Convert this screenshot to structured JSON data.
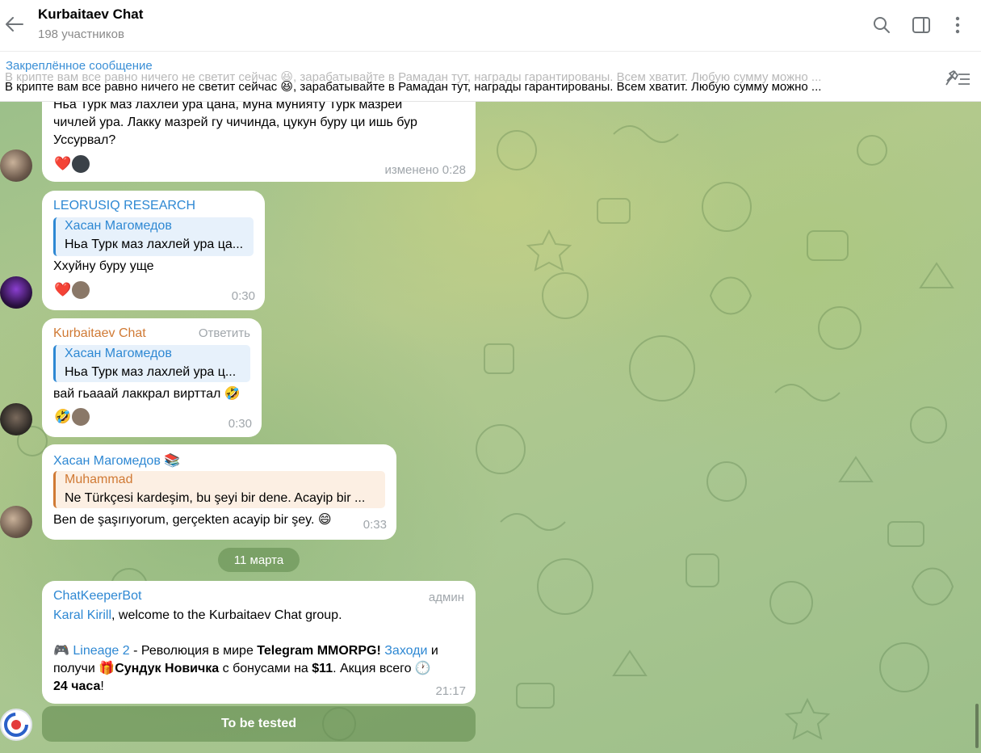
{
  "header": {
    "title": "Kurbaitaev Chat",
    "subtitle": "198 участников"
  },
  "pinned": {
    "label": "Закреплённое сообщение",
    "text": "В крипте вам все равно ничего не светит сейчас 😆, зарабатывайте в Рамадан тут, награды гарантированы. Всем хватит. Любую сумму можно ..."
  },
  "messages": [
    {
      "lines": [
        "Ньа Турк маз лахлей ура цана, муна мунияту Турк мазрей",
        "чичлей ура. Лакку мазрей гу чичинда, цукун буру ци ишь бур",
        "Уссурвал?"
      ],
      "reaction": "❤️",
      "time": "изменено 0:28"
    },
    {
      "sender": "LEORUSIQ RESEARCH",
      "reply_name": "Хасан Магомедов",
      "reply_text": "Ньа Турк маз лахлей ура ца...",
      "text": "Ххуйну буру уще",
      "reaction": "❤️",
      "time": "0:30"
    },
    {
      "sender": "Kurbaitaev Chat",
      "reply_action": "Ответить",
      "reply_name": "Хасан Магомедов",
      "reply_text": "Ньа Турк маз лахлей ура ц...",
      "text": "вай гьааай лаккрал вирттал 🤣",
      "reaction": "🤣",
      "time": "0:30"
    },
    {
      "sender": "Хасан Магомедов 📚",
      "reply_name": "Muhammad",
      "reply_text": "Ne Türkçesi kardeşim, bu şeyi bir dene. Acayip bir ...",
      "text": "Ben de şaşırıyorum, gerçekten acayip bir şey. 😄",
      "time": "0:33"
    }
  ],
  "date_separator": "11 марта",
  "bot_message": {
    "sender": "ChatKeeperBot",
    "badge": "админ",
    "mention": "Karal Kirill",
    "welcome": ", welcome to the Kurbaitaev Chat group.",
    "ad_icon": "🎮",
    "ad_link": "Lineage 2",
    "ad_part1": " - Революция в мире ",
    "ad_bold1": "Telegram MMORPG!",
    "ad_link2": "Заходи",
    "ad_part2": " и",
    "ad_part3": "получи ",
    "ad_gift": "🎁",
    "ad_bold2": "Сундук Новичка",
    "ad_part4": " с бонусами на ",
    "ad_bold3": "$11",
    "ad_part5": ". Акция всего ",
    "ad_clock": "🕐",
    "ad_bold4": "24 часа",
    "ad_end": "!",
    "time": "21:17"
  },
  "keyboard_button": "To be tested",
  "icons": {
    "back": "back-arrow-icon",
    "search": "search-icon",
    "sidebar": "sidebar-toggle-icon",
    "more": "more-vertical-icon",
    "unpin": "unpin-icon"
  },
  "colors": {
    "link": "#2e88d3",
    "sender_blue": "#2e88d3",
    "sender_orange": "#d07a35",
    "reply_blue_bg": "#e7f1fb",
    "reply_orange_bg": "#fcefe3"
  }
}
